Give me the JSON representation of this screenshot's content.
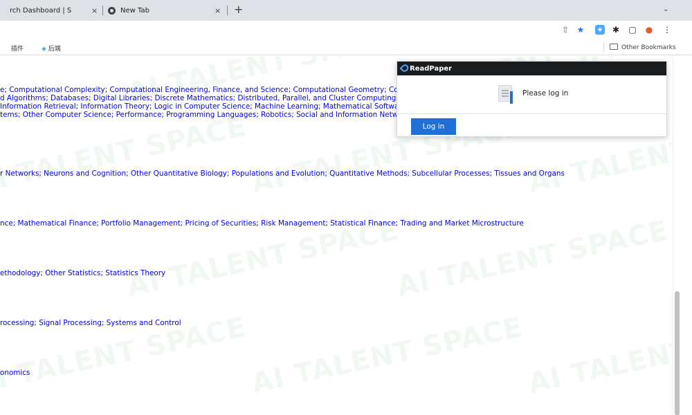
{
  "tabs": [
    {
      "title": "rch Dashboard | S",
      "close": "×"
    },
    {
      "title": "New Tab",
      "close": "×"
    }
  ],
  "new_tab_label": "+",
  "tab_search_label": "⌄",
  "toolbar": {
    "share_icon": "⇧",
    "star_icon": "★",
    "readpaper_ext_icon": "◈",
    "extensions_icon": "✱",
    "sidepanel_icon": "▢",
    "profile_icon": "●",
    "menu_icon": "⋮"
  },
  "bookmarks": {
    "items": [
      "插件",
      "后端"
    ],
    "other": "Other Bookmarks"
  },
  "subjects": [
    {
      "text": "e; Computational Complexity; Computational Engineering, Finance, and Science; Computational Geometry; Computation and Language"
    },
    {
      "text": "d Algorithms; Databases; Digital Libraries; Discrete Mathematics; Distributed, Parallel, and Cluster Computing; Emerging Technologies"
    },
    {
      "text": "Information Retrieval; Information Theory; Logic in Computer Science; Machine Learning; Mathematical Software; Multiagent Systems"
    },
    {
      "text": "tems; Other Computer Science; Performance; Programming Languages; Robotics; Social and Information Networks"
    },
    {
      "text": "r Networks; Neurons and Cognition; Other Quantitative Biology; Populations and Evolution; Quantitative Methods; Subcellular Processes; Tissues and Organs"
    },
    {
      "text": "nce; Mathematical Finance; Portfolio Management; Pricing of Securities; Risk Management; Statistical Finance; Trading and Market Microstructure"
    },
    {
      "text": "ethodology; Other Statistics; Statistics Theory"
    },
    {
      "text": "rocessing; Signal Processing; Systems and Control"
    },
    {
      "text": "onomics"
    }
  ],
  "watermark": "AI TALENT SPACE",
  "popup": {
    "brand": "ReadPaper",
    "message": "Please log in",
    "login_label": "Log in"
  }
}
